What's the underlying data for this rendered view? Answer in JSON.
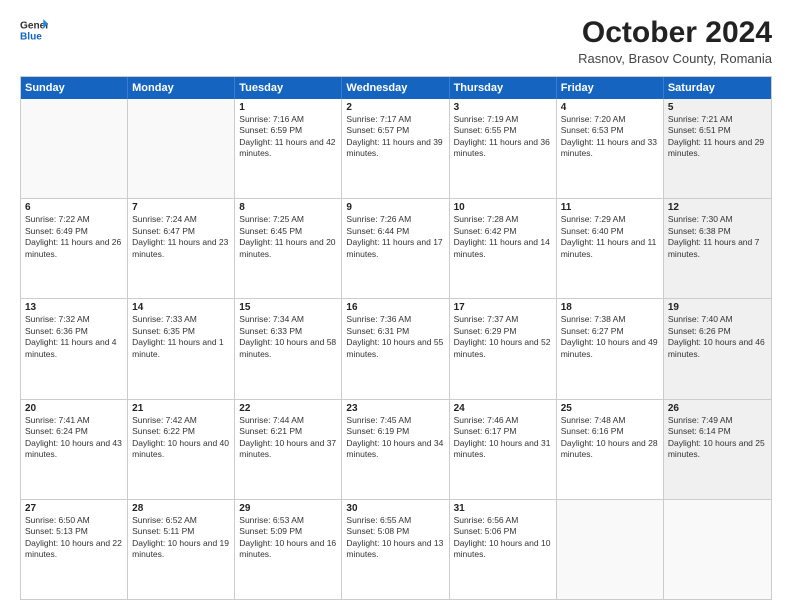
{
  "header": {
    "logo_general": "General",
    "logo_blue": "Blue",
    "month_title": "October 2024",
    "subtitle": "Rasnov, Brasov County, Romania"
  },
  "calendar": {
    "days_of_week": [
      "Sunday",
      "Monday",
      "Tuesday",
      "Wednesday",
      "Thursday",
      "Friday",
      "Saturday"
    ],
    "rows": [
      [
        {
          "day": "",
          "text": "",
          "empty": true
        },
        {
          "day": "",
          "text": "",
          "empty": true
        },
        {
          "day": "1",
          "text": "Sunrise: 7:16 AM\nSunset: 6:59 PM\nDaylight: 11 hours and 42 minutes."
        },
        {
          "day": "2",
          "text": "Sunrise: 7:17 AM\nSunset: 6:57 PM\nDaylight: 11 hours and 39 minutes."
        },
        {
          "day": "3",
          "text": "Sunrise: 7:19 AM\nSunset: 6:55 PM\nDaylight: 11 hours and 36 minutes."
        },
        {
          "day": "4",
          "text": "Sunrise: 7:20 AM\nSunset: 6:53 PM\nDaylight: 11 hours and 33 minutes."
        },
        {
          "day": "5",
          "text": "Sunrise: 7:21 AM\nSunset: 6:51 PM\nDaylight: 11 hours and 29 minutes.",
          "shaded": true
        }
      ],
      [
        {
          "day": "6",
          "text": "Sunrise: 7:22 AM\nSunset: 6:49 PM\nDaylight: 11 hours and 26 minutes."
        },
        {
          "day": "7",
          "text": "Sunrise: 7:24 AM\nSunset: 6:47 PM\nDaylight: 11 hours and 23 minutes."
        },
        {
          "day": "8",
          "text": "Sunrise: 7:25 AM\nSunset: 6:45 PM\nDaylight: 11 hours and 20 minutes."
        },
        {
          "day": "9",
          "text": "Sunrise: 7:26 AM\nSunset: 6:44 PM\nDaylight: 11 hours and 17 minutes."
        },
        {
          "day": "10",
          "text": "Sunrise: 7:28 AM\nSunset: 6:42 PM\nDaylight: 11 hours and 14 minutes."
        },
        {
          "day": "11",
          "text": "Sunrise: 7:29 AM\nSunset: 6:40 PM\nDaylight: 11 hours and 11 minutes."
        },
        {
          "day": "12",
          "text": "Sunrise: 7:30 AM\nSunset: 6:38 PM\nDaylight: 11 hours and 7 minutes.",
          "shaded": true
        }
      ],
      [
        {
          "day": "13",
          "text": "Sunrise: 7:32 AM\nSunset: 6:36 PM\nDaylight: 11 hours and 4 minutes."
        },
        {
          "day": "14",
          "text": "Sunrise: 7:33 AM\nSunset: 6:35 PM\nDaylight: 11 hours and 1 minute."
        },
        {
          "day": "15",
          "text": "Sunrise: 7:34 AM\nSunset: 6:33 PM\nDaylight: 10 hours and 58 minutes."
        },
        {
          "day": "16",
          "text": "Sunrise: 7:36 AM\nSunset: 6:31 PM\nDaylight: 10 hours and 55 minutes."
        },
        {
          "day": "17",
          "text": "Sunrise: 7:37 AM\nSunset: 6:29 PM\nDaylight: 10 hours and 52 minutes."
        },
        {
          "day": "18",
          "text": "Sunrise: 7:38 AM\nSunset: 6:27 PM\nDaylight: 10 hours and 49 minutes."
        },
        {
          "day": "19",
          "text": "Sunrise: 7:40 AM\nSunset: 6:26 PM\nDaylight: 10 hours and 46 minutes.",
          "shaded": true
        }
      ],
      [
        {
          "day": "20",
          "text": "Sunrise: 7:41 AM\nSunset: 6:24 PM\nDaylight: 10 hours and 43 minutes."
        },
        {
          "day": "21",
          "text": "Sunrise: 7:42 AM\nSunset: 6:22 PM\nDaylight: 10 hours and 40 minutes."
        },
        {
          "day": "22",
          "text": "Sunrise: 7:44 AM\nSunset: 6:21 PM\nDaylight: 10 hours and 37 minutes."
        },
        {
          "day": "23",
          "text": "Sunrise: 7:45 AM\nSunset: 6:19 PM\nDaylight: 10 hours and 34 minutes."
        },
        {
          "day": "24",
          "text": "Sunrise: 7:46 AM\nSunset: 6:17 PM\nDaylight: 10 hours and 31 minutes."
        },
        {
          "day": "25",
          "text": "Sunrise: 7:48 AM\nSunset: 6:16 PM\nDaylight: 10 hours and 28 minutes."
        },
        {
          "day": "26",
          "text": "Sunrise: 7:49 AM\nSunset: 6:14 PM\nDaylight: 10 hours and 25 minutes.",
          "shaded": true
        }
      ],
      [
        {
          "day": "27",
          "text": "Sunrise: 6:50 AM\nSunset: 5:13 PM\nDaylight: 10 hours and 22 minutes."
        },
        {
          "day": "28",
          "text": "Sunrise: 6:52 AM\nSunset: 5:11 PM\nDaylight: 10 hours and 19 minutes."
        },
        {
          "day": "29",
          "text": "Sunrise: 6:53 AM\nSunset: 5:09 PM\nDaylight: 10 hours and 16 minutes."
        },
        {
          "day": "30",
          "text": "Sunrise: 6:55 AM\nSunset: 5:08 PM\nDaylight: 10 hours and 13 minutes."
        },
        {
          "day": "31",
          "text": "Sunrise: 6:56 AM\nSunset: 5:06 PM\nDaylight: 10 hours and 10 minutes."
        },
        {
          "day": "",
          "text": "",
          "empty": true
        },
        {
          "day": "",
          "text": "",
          "empty": true,
          "shaded": true
        }
      ]
    ]
  }
}
